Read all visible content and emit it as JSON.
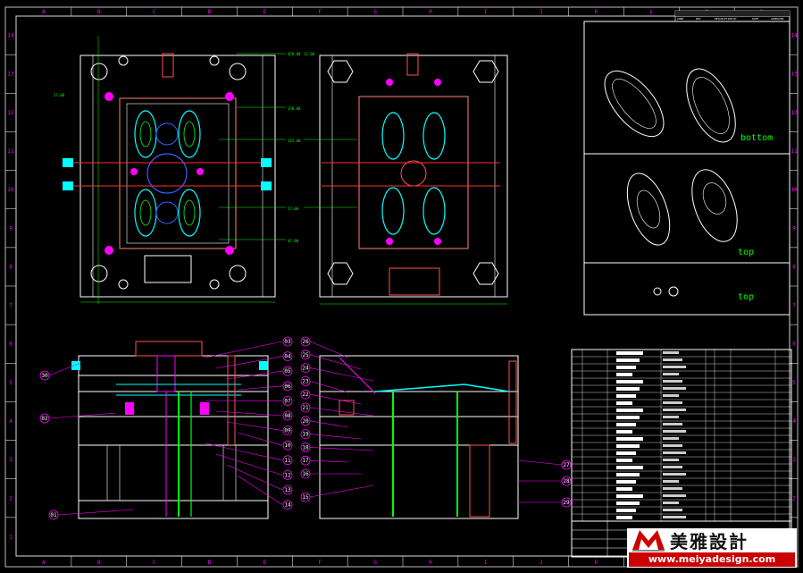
{
  "colors": {
    "background": "#000000",
    "frame": "#ffffff",
    "dim": "#00ff00",
    "cyan": "#00ffff",
    "magenta": "#ff00ff",
    "red": "#ff0000",
    "yellow": "#ffff00",
    "blue": "#3a5bff"
  },
  "border_columns": [
    "A",
    "B",
    "C",
    "D",
    "E",
    "F",
    "G",
    "H",
    "I",
    "J",
    "K",
    "L",
    "M",
    "N"
  ],
  "border_rows": [
    "14",
    "13",
    "12",
    "11",
    "10",
    "9",
    "8",
    "7",
    "6",
    "5",
    "4",
    "3",
    "2",
    "1"
  ],
  "views": {
    "bottom_label": "bottom",
    "top_label_1": "top",
    "top_label_2": "top"
  },
  "callouts_left": [
    "03",
    "04",
    "05",
    "06",
    "07",
    "08",
    "09",
    "10",
    "11",
    "12",
    "13",
    "14"
  ],
  "callouts_right": [
    "26",
    "25",
    "24",
    "23",
    "22",
    "21",
    "20",
    "19",
    "18",
    "17",
    "16",
    "15"
  ],
  "callouts_outer": [
    "30",
    "02",
    "01",
    "27",
    "28",
    "29"
  ],
  "revision_header": [
    "ZONE",
    "REV",
    "DESCRIPTION",
    "BY",
    "DATE",
    "APPROVED"
  ],
  "dims_sample": [
    "450.00",
    "150.00",
    "115.00",
    "57.00",
    "47.00",
    "27.00",
    "12.00"
  ],
  "logo": {
    "cn": "美雅設計",
    "url": "www.meiyadesign.com"
  }
}
